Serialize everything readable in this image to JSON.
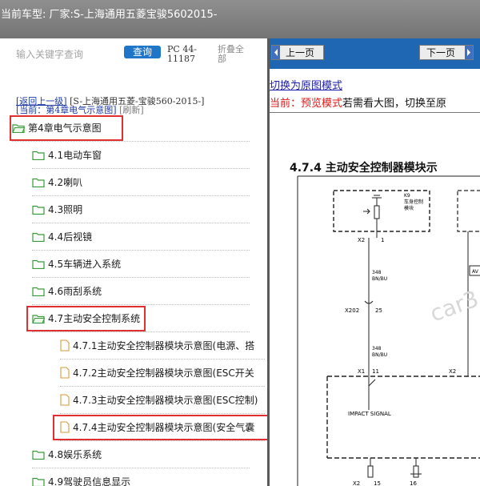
{
  "header": {
    "current_vehicle": "当前车型:  厂家:S-上海通用五菱宝骏5602015-"
  },
  "left_panel": {
    "search_placeholder": "输入关键字查询",
    "query_button": "查询",
    "pc_code": "PC 44-11187",
    "collapse_all": "折叠全部",
    "breadcrumb_back": "[返回上一级]",
    "breadcrumb_path": "[S-上海通用五菱-宝骏560-2015-]",
    "current_prefix": "[当前：",
    "current_label": "第4章电气示意图",
    "current_suffix": "]",
    "refresh": "[刷新]",
    "tree": {
      "chapter": "第4章电气示意图",
      "items": [
        {
          "label": "4.1电动车窗"
        },
        {
          "label": "4.2喇叭"
        },
        {
          "label": "4.3照明"
        },
        {
          "label": "4.4后视镜"
        },
        {
          "label": "4.5车辆进入系统"
        },
        {
          "label": "4.6雨刮系统"
        },
        {
          "label": "4.7主动安全控制系统"
        },
        {
          "label": "4.7.1主动安全控制器模块示意图(电源、搭"
        },
        {
          "label": "4.7.2主动安全控制器模块示意图(ESC开关"
        },
        {
          "label": "4.7.3主动安全控制器模块示意图(ESC控制)"
        },
        {
          "label": "4.7.4主动安全控制器模块示意图(安全气囊"
        },
        {
          "label": "4.8娱乐系统"
        },
        {
          "label": "4.9驾驶员信息显示"
        }
      ]
    }
  },
  "right_panel": {
    "prev_page": "上一页",
    "next_page": "下一页",
    "switch_link": "切换为原图模式",
    "mode_current": "当前：",
    "mode_name": "预览模式",
    "mode_hint": "若需看大图，切换至原",
    "diagram": {
      "heading": "4.7.4 主动安全控制器模块示",
      "module_label_line1": "K9",
      "module_label_line2": "车身控制",
      "module_label_line3": "模块",
      "pin_x2_1": "X2",
      "pin_1": "1",
      "wire1_num": "348",
      "wire1_color": "BN/BU",
      "connector": "X202",
      "connector_pin": "25",
      "wire2_num": "348",
      "wire2_color": "BN/BU",
      "pin_x1": "X1",
      "pin_11": "11",
      "pin_x2b": "X2",
      "impact": "IMPACT SIGNAL",
      "bottom_x2": "X2",
      "bottom_15": "15",
      "bottom_16": "16",
      "right_av": "AV",
      "watermark": "car3"
    }
  }
}
